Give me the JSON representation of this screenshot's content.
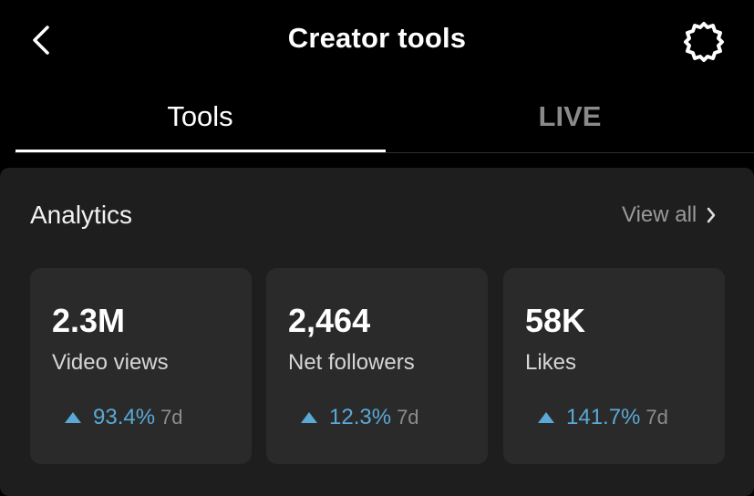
{
  "header": {
    "title": "Creator tools",
    "back_icon": "chevron-left-icon",
    "settings_icon": "gear-icon"
  },
  "tabs": [
    {
      "label": "Tools",
      "active": true
    },
    {
      "label": "LIVE",
      "active": false
    }
  ],
  "analytics": {
    "title": "Analytics",
    "view_all_label": "View all",
    "cards": [
      {
        "value": "2.3M",
        "label": "Video views",
        "change": "93.4%",
        "period": "7d",
        "trend": "up"
      },
      {
        "value": "2,464",
        "label": "Net followers",
        "change": "12.3%",
        "period": "7d",
        "trend": "up"
      },
      {
        "value": "58K",
        "label": "Likes",
        "change": "141.7%",
        "period": "7d",
        "trend": "up"
      }
    ]
  },
  "colors": {
    "background": "#000000",
    "panel": "#1e1e1e",
    "card": "#2a2a2a",
    "accent_up": "#5aa9d6",
    "inactive_tab": "#8a8a8a"
  }
}
